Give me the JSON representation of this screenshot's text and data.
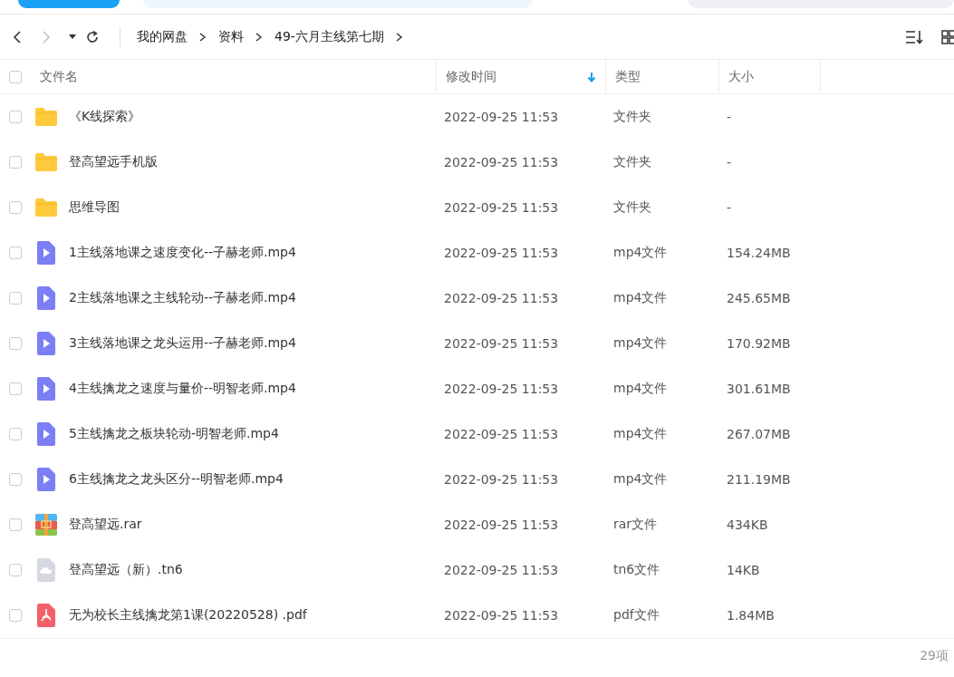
{
  "breadcrumb": [
    "我的网盘",
    "资料",
    "49-六月主线第七期"
  ],
  "table": {
    "select_all_checked": false,
    "columns": [
      {
        "label": "文件名",
        "sorted": false
      },
      {
        "label": "修改时间",
        "sorted": true
      },
      {
        "label": "类型",
        "sorted": false
      },
      {
        "label": "大小",
        "sorted": false
      }
    ],
    "rows": [
      {
        "kind": "folder",
        "name": "《K线探索》",
        "modified": "2022-09-25 11:53",
        "type": "文件夹",
        "size": "-",
        "checked": false
      },
      {
        "kind": "folder",
        "name": "登高望远手机版",
        "modified": "2022-09-25 11:53",
        "type": "文件夹",
        "size": "-",
        "checked": false
      },
      {
        "kind": "folder",
        "name": "思维导图",
        "modified": "2022-09-25 11:53",
        "type": "文件夹",
        "size": "-",
        "checked": false
      },
      {
        "kind": "video",
        "name": "1主线落地课之速度变化--子赫老师.mp4",
        "modified": "2022-09-25 11:53",
        "type": "mp4文件",
        "size": "154.24MB",
        "checked": false
      },
      {
        "kind": "video",
        "name": "2主线落地课之主线轮动--子赫老师.mp4",
        "modified": "2022-09-25 11:53",
        "type": "mp4文件",
        "size": "245.65MB",
        "checked": false
      },
      {
        "kind": "video",
        "name": "3主线落地课之龙头运用--子赫老师.mp4",
        "modified": "2022-09-25 11:53",
        "type": "mp4文件",
        "size": "170.92MB",
        "checked": false
      },
      {
        "kind": "video",
        "name": "4主线擒龙之速度与量价--明智老师.mp4",
        "modified": "2022-09-25 11:53",
        "type": "mp4文件",
        "size": "301.61MB",
        "checked": false
      },
      {
        "kind": "video",
        "name": "5主线擒龙之板块轮动-明智老师.mp4",
        "modified": "2022-09-25 11:53",
        "type": "mp4文件",
        "size": "267.07MB",
        "checked": false
      },
      {
        "kind": "video",
        "name": "6主线擒龙之龙头区分--明智老师.mp4",
        "modified": "2022-09-25 11:53",
        "type": "mp4文件",
        "size": "211.19MB",
        "checked": false
      },
      {
        "kind": "archive",
        "name": "登高望远.rar",
        "modified": "2022-09-25 11:53",
        "type": "rar文件",
        "size": "434KB",
        "checked": false
      },
      {
        "kind": "cloud",
        "name": "登高望远（新）.tn6",
        "modified": "2022-09-25 11:53",
        "type": "tn6文件",
        "size": "14KB",
        "checked": false
      },
      {
        "kind": "pdf",
        "name": "无为校长主线擒龙第1课(20220528) .pdf",
        "modified": "2022-09-25 11:53",
        "type": "pdf文件",
        "size": "1.84MB",
        "checked": false
      }
    ]
  },
  "status_bar": {
    "count": "29项"
  }
}
